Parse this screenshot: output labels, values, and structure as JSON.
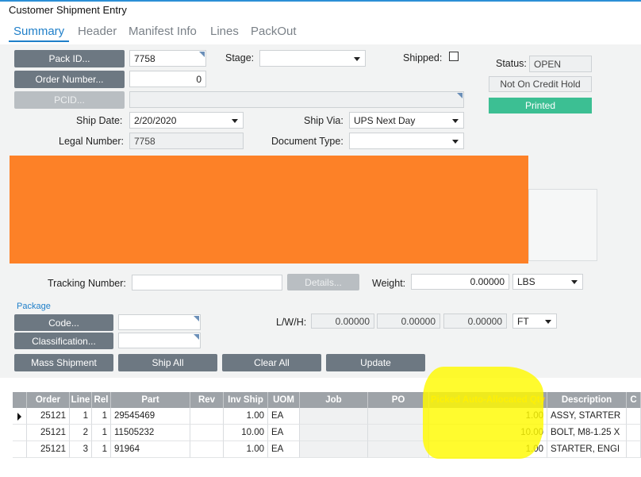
{
  "window": {
    "title": "Customer Shipment Entry"
  },
  "tabs": [
    {
      "label": "Summary"
    },
    {
      "label": "Header"
    },
    {
      "label": "Manifest Info"
    },
    {
      "label": "Lines"
    },
    {
      "label": "PackOut"
    }
  ],
  "form": {
    "pack_id_button": "Pack ID...",
    "pack_id_value": "7758",
    "order_number_button": "Order Number...",
    "order_number_value": "0",
    "pcid_button": "PCID...",
    "pcid_value": "",
    "stage_label": "Stage:",
    "stage_value": "",
    "shipped_label": "Shipped:",
    "ship_date_label": "Ship Date:",
    "ship_date_value": "2/20/2020",
    "ship_via_label": "Ship Via:",
    "ship_via_value": "UPS Next Day",
    "legal_number_label": "Legal Number:",
    "legal_number_value": "7758",
    "document_type_label": "Document Type:",
    "document_type_value": "",
    "status_label": "Status:",
    "status_value": "OPEN",
    "credit_hold": "Not On Credit Hold",
    "printed": "Printed",
    "tracking_label": "Tracking Number:",
    "tracking_value": "",
    "details_button": "Details...",
    "weight_label": "Weight:",
    "weight_value": "0.00000",
    "weight_uom": "LBS",
    "package_section": "Package",
    "code_button": "Code...",
    "code_value": "",
    "classification_button": "Classification...",
    "classification_value": "",
    "lwh_label": "L/W/H:",
    "length": "0.00000",
    "width": "0.00000",
    "height": "0.00000",
    "dim_uom": "FT",
    "mass_shipment_button": "Mass Shipment",
    "ship_all_button": "Ship All",
    "clear_all_button": "Clear All",
    "update_button": "Update"
  },
  "grid": {
    "columns": [
      "Order",
      "Line",
      "Rel",
      "Part",
      "Rev",
      "Inv Ship",
      "UOM",
      "Job",
      "PO",
      "Picked Auto-Allocated Qty",
      "Description",
      "C"
    ],
    "rows": [
      {
        "order": "25121",
        "line": "1",
        "rel": "1",
        "part": "29545469",
        "rev": "",
        "inv_ship": "1.00",
        "uom": "EA",
        "job": "",
        "po": "",
        "picked": "1.00",
        "description": "ASSY, STARTER"
      },
      {
        "order": "25121",
        "line": "2",
        "rel": "1",
        "part": "11505232",
        "rev": "",
        "inv_ship": "10.00",
        "uom": "EA",
        "job": "",
        "po": "",
        "picked": "10.00",
        "description": "BOLT, M8-1.25 X"
      },
      {
        "order": "25121",
        "line": "3",
        "rel": "1",
        "part": "91964",
        "rev": "",
        "inv_ship": "1.00",
        "uom": "EA",
        "job": "",
        "po": "",
        "picked": "1.00",
        "description": "STARTER, ENGI"
      }
    ]
  },
  "colors": {
    "accent": "#1f7fc9",
    "button": "#6d7882",
    "printed_green": "#3cbf93",
    "redaction": "#fd8127",
    "highlight": "#fffa00",
    "picked_header_text": "#f6c21c"
  }
}
